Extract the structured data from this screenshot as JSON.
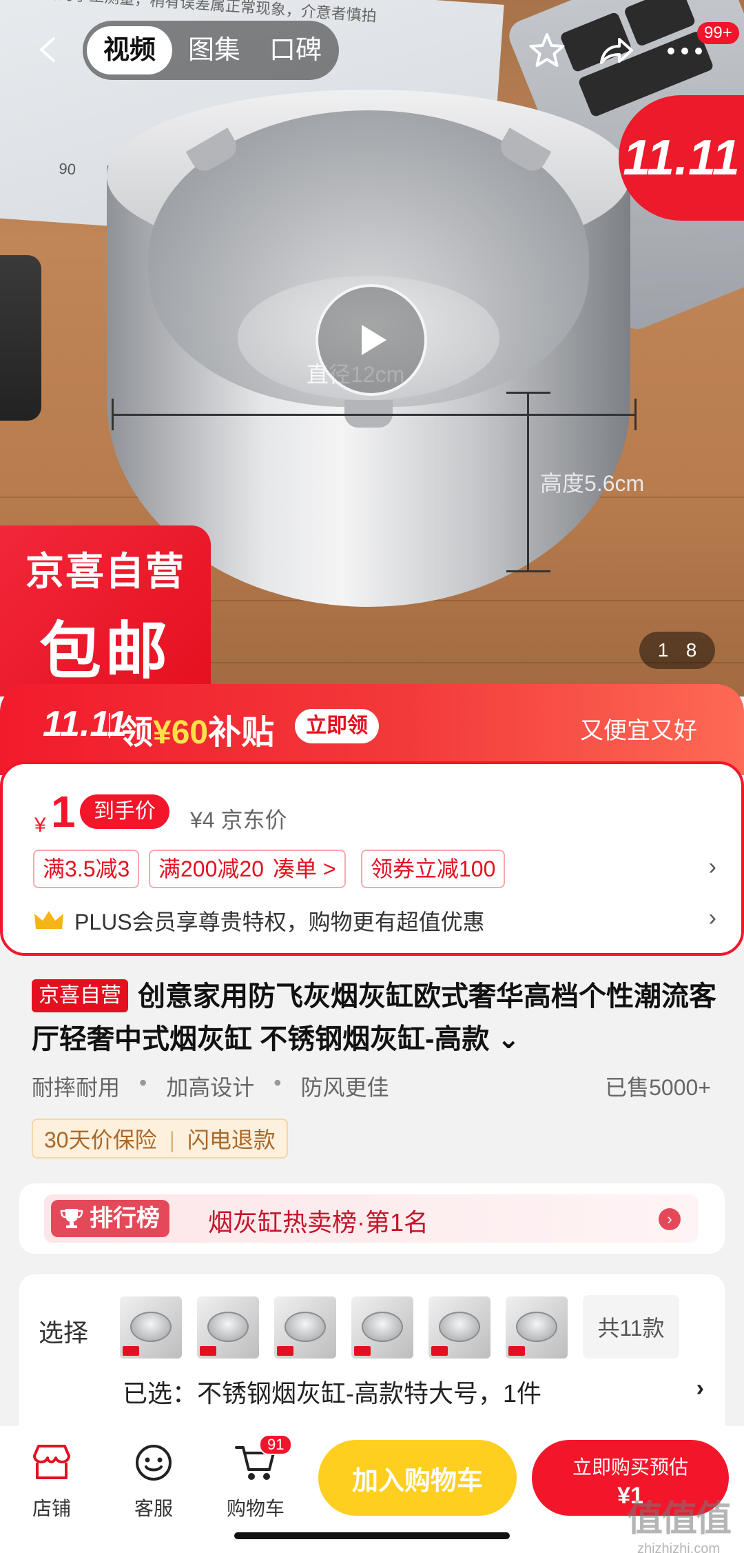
{
  "hero": {
    "paper_text": "*尺寸均为手工测量，稍有误差属正常现象，介意者慎拍",
    "paper_number": "06",
    "dimension_diameter": "直径12cm",
    "dimension_height": "高度5.6cm",
    "badge_line1": "京喜自营",
    "badge_line2": "包邮",
    "corner_logo": "11.11",
    "page_current": "1",
    "page_total": "8"
  },
  "topbar": {
    "tabs": [
      {
        "label": "视频",
        "active": true
      },
      {
        "label": "图集",
        "active": false
      },
      {
        "label": "口碑",
        "active": false
      }
    ],
    "more_badge": "99+"
  },
  "promo_strip": {
    "logo": "11.11",
    "coupon_prefix": "领",
    "coupon_amount": "¥60",
    "coupon_suffix": "补贴",
    "claim_label": "立即领",
    "slogan": "又便宜又好"
  },
  "price": {
    "currency": "¥",
    "final_price": "1",
    "final_tag": "到手价",
    "jd_price": "¥4 京东价",
    "chips": [
      "满3.5减3",
      "满200减20",
      "凑单 >",
      "领券立减100"
    ],
    "plus_text": "PLUS会员享尊贵特权，购物更有超值优惠"
  },
  "product": {
    "self_tag": "京喜自营",
    "title": "创意家用防飞灰烟灰缸欧式奢华高档个性潮流客厅轻奢中式烟灰缸 不锈钢烟灰缸-高款",
    "features": [
      "耐摔耐用",
      "加高设计",
      "防风更佳"
    ],
    "sold": "已售5000+",
    "guarantees": [
      "30天价保险",
      "闪电退款"
    ]
  },
  "rank": {
    "pill_label": "排行榜",
    "text": "烟灰缸热卖榜·第1名"
  },
  "select": {
    "label": "选择",
    "thumb_count": 6,
    "total": "共11款",
    "selected": "已选：不锈钢烟灰缸-高款特大号，1件"
  },
  "bottombar": {
    "shop_label": "店铺",
    "service_label": "客服",
    "cart_label": "购物车",
    "cart_badge": "91",
    "add_cart_label": "加入购物车",
    "buy_line1": "立即购买预估",
    "buy_line2": "¥1"
  },
  "watermark": {
    "logo": "值值值",
    "url": "zhizhizhi.com"
  },
  "colors": {
    "brand_red": "#f3162a",
    "promo_yellow": "#ffe14a",
    "add_cart_yellow": "#ffcf1f"
  }
}
